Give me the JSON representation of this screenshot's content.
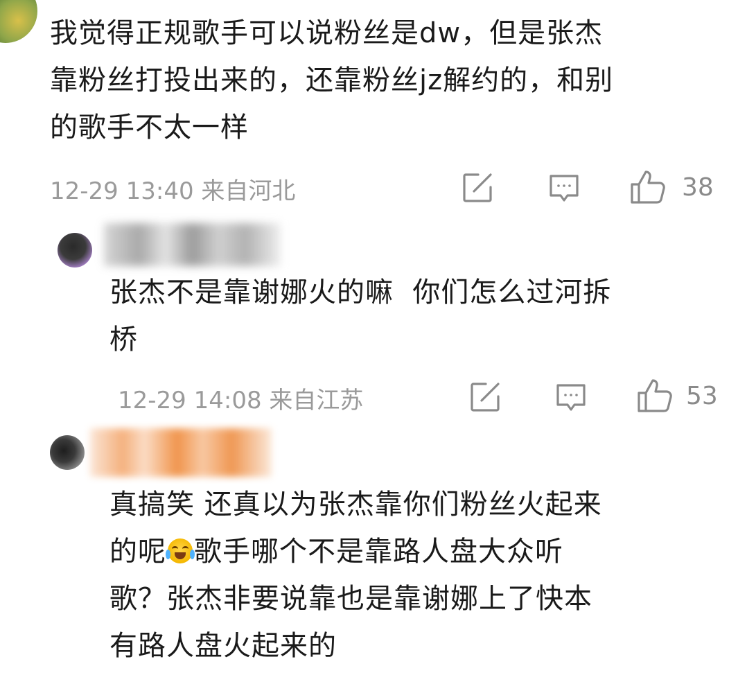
{
  "comments": [
    {
      "text": "我觉得正规歌手可以说粉丝是dw，但是张杰\n靠粉丝打投出来的，还靠粉丝jz解约的，和别\n的歌手不太一样",
      "meta": "12-29 13:40 来自河北",
      "likes": "38"
    },
    {
      "text": "张杰不是靠谢娜火的嘛  你们怎么过河拆\n桥",
      "meta": "12-29 14:08 来自江苏",
      "likes": "53"
    },
    {
      "text_part1": "真搞笑 还真以为张杰靠你们粉丝火起来\n的呢",
      "emoji": "crying-laughing-emoji",
      "text_part2": "歌手哪个不是靠路人盘大众听\n歌？张杰非要说靠也是靠谢娜上了快本\n有路人盘火起来的"
    }
  ],
  "icons": {
    "repost": "edit-share-icon",
    "comment": "comment-bubble-icon",
    "like": "thumbs-up-icon"
  },
  "colors": {
    "text": "#1a1a1a",
    "meta": "#9a9a9a",
    "icon": "#8a8a8a"
  }
}
